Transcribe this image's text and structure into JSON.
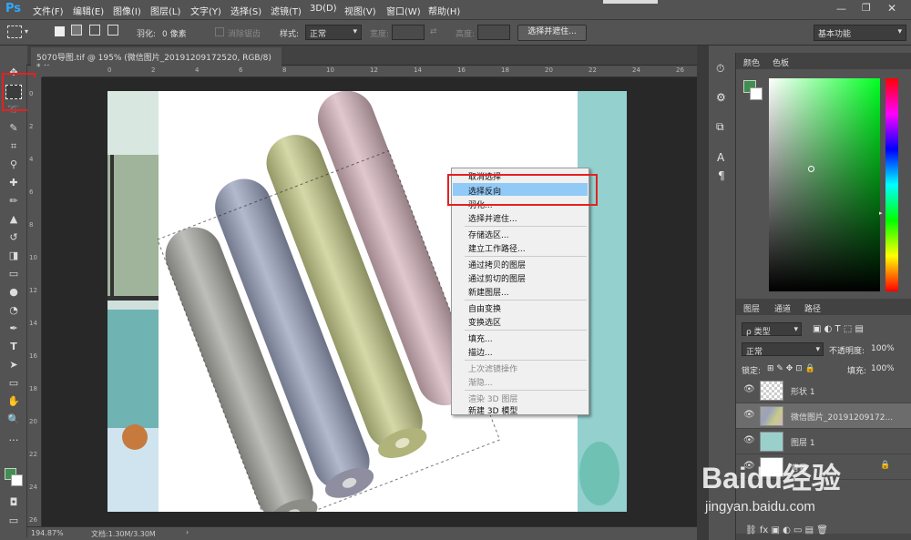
{
  "app": {
    "logo": "Ps"
  },
  "menu": [
    "文件(F)",
    "编辑(E)",
    "图像(I)",
    "图层(L)",
    "文字(Y)",
    "选择(S)",
    "滤镜(T)",
    "3D(D)",
    "视图(V)",
    "窗口(W)",
    "帮助(H)"
  ],
  "options": {
    "feather_label": "羽化:",
    "feather_value": "0 像素",
    "antialias_label": "消除锯齿",
    "style_label": "样式:",
    "style_value": "正常",
    "width_label": "宽度:",
    "height_label": "高度:",
    "select_mask_button": "选择并遮住...",
    "workspace": "基本功能"
  },
  "document_tab": {
    "title": "5070导图.tif @ 195% (微信图片_20191209172520, RGB/8) *",
    "close": "×"
  },
  "ruler": {
    "h_ticks": [
      "0",
      "2",
      "4",
      "6",
      "8",
      "10",
      "12",
      "14",
      "16",
      "18",
      "20",
      "22",
      "24",
      "26",
      "28"
    ],
    "v_ticks": [
      "0",
      "2",
      "4",
      "6",
      "8",
      "10",
      "12",
      "14",
      "16",
      "18",
      "20",
      "22",
      "24",
      "26"
    ]
  },
  "status": {
    "zoom": "194.87%",
    "doc": "文档:1.30M/3.30M"
  },
  "context_menu": {
    "items": [
      {
        "label": "取消选择",
        "disabled": false
      },
      {
        "label": "选择反向",
        "disabled": false,
        "highlighted": true
      },
      {
        "label": "羽化...",
        "disabled": false
      },
      {
        "label": "选择并遮住...",
        "disabled": false
      },
      {
        "label": "存储选区...",
        "disabled": false
      },
      {
        "label": "建立工作路径...",
        "disabled": false
      },
      {
        "label": "通过拷贝的图层",
        "disabled": false
      },
      {
        "label": "通过剪切的图层",
        "disabled": false
      },
      {
        "label": "新建图层...",
        "disabled": false
      },
      {
        "label": "自由变换",
        "disabled": false
      },
      {
        "label": "变换选区",
        "disabled": false
      },
      {
        "label": "填充...",
        "disabled": false
      },
      {
        "label": "描边...",
        "disabled": false
      },
      {
        "label": "上次滤镜操作",
        "disabled": true
      },
      {
        "label": "渐隐...",
        "disabled": true
      },
      {
        "label": "渲染 3D 图层",
        "disabled": true
      },
      {
        "label": "新建 3D 模型",
        "disabled": false
      }
    ]
  },
  "color_panel": {
    "tabs": [
      "颜色",
      "色板"
    ],
    "fg": "#3f8f4f",
    "bg": "#ffffff"
  },
  "layers_panel": {
    "tabs": [
      "图层",
      "通道",
      "路径"
    ],
    "kind_label": "ρ 类型",
    "blend_mode": "正常",
    "opacity_label": "不透明度:",
    "opacity_value": "100%",
    "lock_label": "锁定:",
    "fill_label": "填充:",
    "fill_value": "100%",
    "layers": [
      {
        "name": "形状 1"
      },
      {
        "name": "微信图片_20191209172..."
      },
      {
        "name": "图层 1"
      },
      {
        "name": "背景"
      }
    ]
  },
  "watermark": {
    "brand": "Baidu经验",
    "url": "jingyan.baidu.com"
  }
}
